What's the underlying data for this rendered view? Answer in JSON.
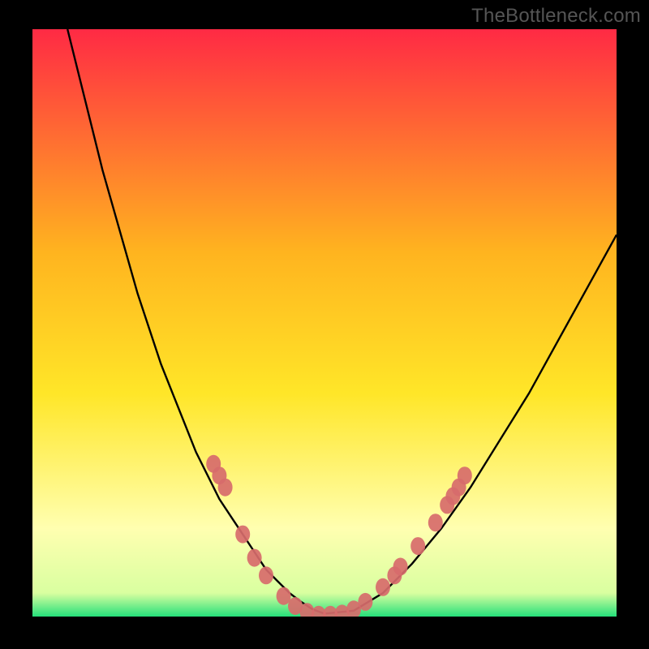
{
  "watermark": "TheBottleneck.com",
  "colors": {
    "frame": "#000000",
    "gradient_top": "#ff2a44",
    "gradient_mid1": "#ffb41f",
    "gradient_mid2": "#ffe628",
    "gradient_pale": "#ffffb0",
    "gradient_bottom": "#25e07a",
    "curve": "#000000",
    "markers": "#d76b6b"
  },
  "chart_data": {
    "type": "line",
    "title": "",
    "xlabel": "",
    "ylabel": "",
    "xlim": [
      0,
      100
    ],
    "ylim": [
      0,
      100
    ],
    "grid": false,
    "legend": false,
    "series": [
      {
        "name": "bottleneck-curve",
        "x": [
          6,
          8,
          10,
          12,
          14,
          16,
          18,
          20,
          22,
          24,
          26,
          28,
          30,
          32,
          34,
          36,
          38,
          40,
          42,
          44,
          46,
          48,
          50,
          55,
          60,
          65,
          70,
          75,
          80,
          85,
          90,
          95,
          100
        ],
        "y": [
          100,
          92,
          84,
          76,
          69,
          62,
          55,
          49,
          43,
          38,
          33,
          28,
          24,
          20,
          17,
          14,
          11,
          8,
          6,
          4,
          2.5,
          1.2,
          0.5,
          1,
          4,
          9,
          15,
          22,
          30,
          38,
          47,
          56,
          65
        ],
        "color": "#000000"
      }
    ],
    "markers": {
      "name": "highlighted-points",
      "color": "#d76b6b",
      "points": [
        {
          "x": 31,
          "y": 26
        },
        {
          "x": 32,
          "y": 24
        },
        {
          "x": 33,
          "y": 22
        },
        {
          "x": 36,
          "y": 14
        },
        {
          "x": 38,
          "y": 10
        },
        {
          "x": 40,
          "y": 7
        },
        {
          "x": 43,
          "y": 3.5
        },
        {
          "x": 45,
          "y": 1.8
        },
        {
          "x": 47,
          "y": 0.8
        },
        {
          "x": 49,
          "y": 0.3
        },
        {
          "x": 51,
          "y": 0.3
        },
        {
          "x": 53,
          "y": 0.5
        },
        {
          "x": 55,
          "y": 1.2
        },
        {
          "x": 57,
          "y": 2.5
        },
        {
          "x": 60,
          "y": 5
        },
        {
          "x": 62,
          "y": 7
        },
        {
          "x": 63,
          "y": 8.5
        },
        {
          "x": 66,
          "y": 12
        },
        {
          "x": 69,
          "y": 16
        },
        {
          "x": 71,
          "y": 19
        },
        {
          "x": 72,
          "y": 20.5
        },
        {
          "x": 73,
          "y": 22
        },
        {
          "x": 74,
          "y": 24
        }
      ]
    }
  }
}
